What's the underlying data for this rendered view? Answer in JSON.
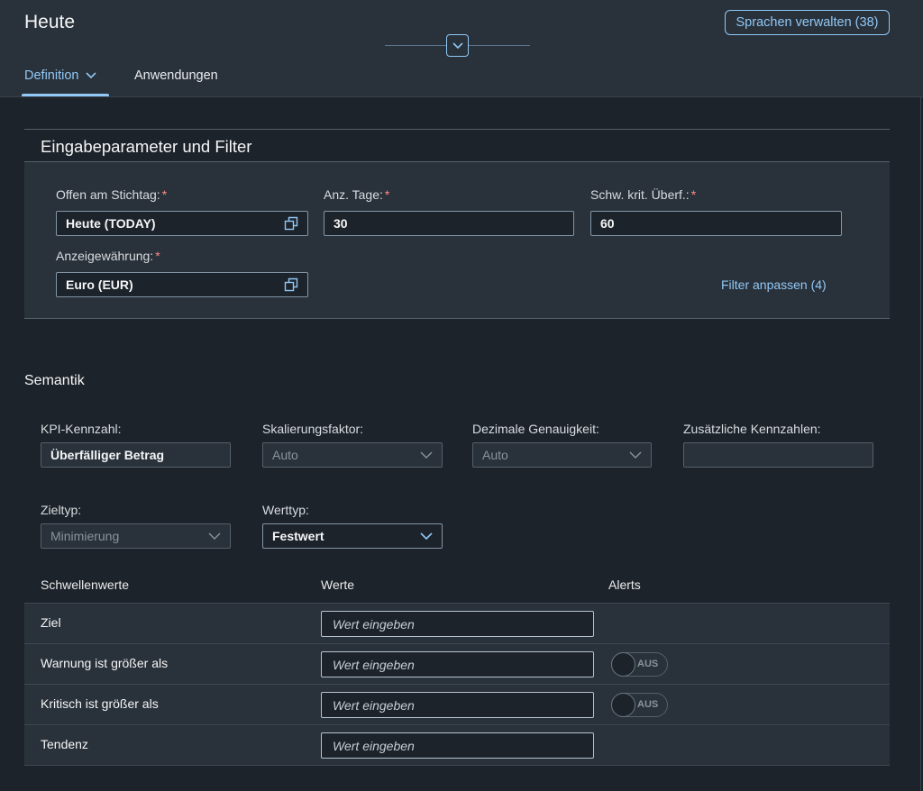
{
  "header": {
    "title": "Heute",
    "manage_languages": "Sprachen verwalten (38)",
    "tabs": [
      {
        "label": "Definition"
      },
      {
        "label": "Anwendungen"
      }
    ]
  },
  "filter_panel": {
    "title": "Eingabeparameter und Filter",
    "fields": {
      "open_on": {
        "label": "Offen am Stichtag:",
        "value": "Heute (TODAY)"
      },
      "days": {
        "label": "Anz. Tage:",
        "value": "30"
      },
      "threshold": {
        "label": "Schw. krit. Überf.:",
        "value": "60"
      },
      "currency": {
        "label": "Anzeigewährung:",
        "value": "Euro (EUR)"
      }
    },
    "required_mark": "*",
    "adapt_filters": "Filter anpassen (4)"
  },
  "semantics": {
    "title": "Semantik",
    "kpi": {
      "label": "KPI-Kennzahl:",
      "value": "Überfälliger Betrag"
    },
    "scaling": {
      "label": "Skalierungsfaktor:",
      "value": "Auto"
    },
    "decimals": {
      "label": "Dezimale Genauigkeit:",
      "value": "Auto"
    },
    "additional": {
      "label": "Zusätzliche Kennzahlen:",
      "value": ""
    },
    "goal_type": {
      "label": "Zieltyp:",
      "value": "Minimierung"
    },
    "value_type": {
      "label": "Werttyp:",
      "value": "Festwert"
    }
  },
  "thresholds": {
    "headers": [
      "Schwellenwerte",
      "Werte",
      "Alerts"
    ],
    "rows": [
      {
        "label": "Ziel",
        "placeholder": "Wert eingeben"
      },
      {
        "label": "Warnung ist größer als",
        "placeholder": "Wert eingeben",
        "switch": "AUS"
      },
      {
        "label": "Kritisch ist größer als",
        "placeholder": "Wert eingeben",
        "switch": "AUS"
      },
      {
        "label": "Tendenz",
        "placeholder": "Wert eingeben"
      }
    ]
  },
  "colors": {
    "accent": "#91c8f6",
    "background": "#1d232a",
    "panel": "#29313a",
    "required": "#ff8888"
  }
}
